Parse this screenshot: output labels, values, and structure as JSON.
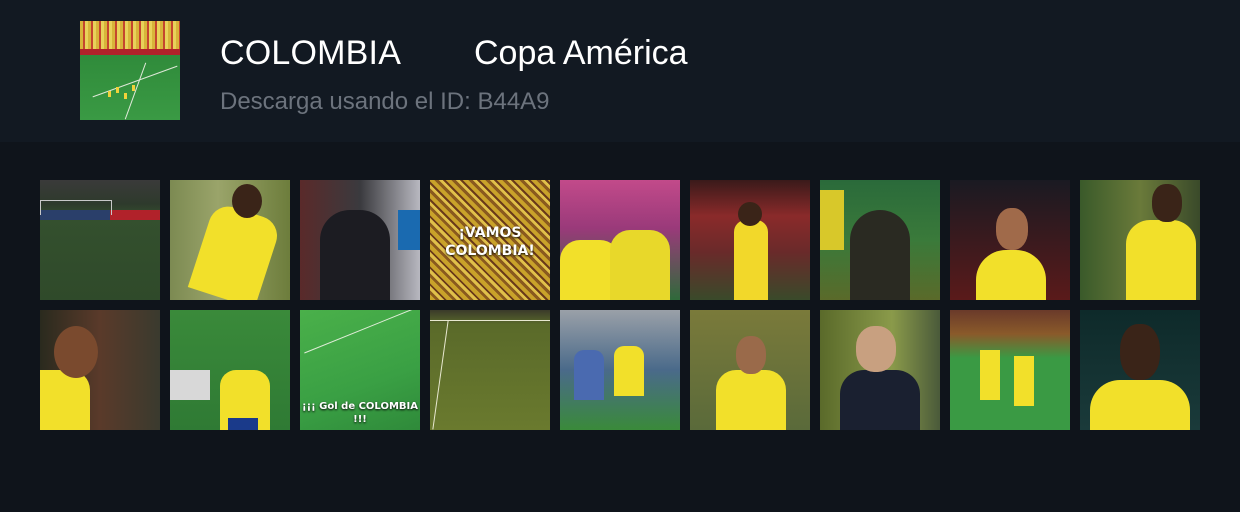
{
  "header": {
    "team": "COLOMBIA",
    "competition": "Copa América",
    "download_text": "Descarga usando el ID: B44A9"
  },
  "thumbnails": {
    "row1": [
      {
        "name": "wide-pitch-clip"
      },
      {
        "name": "player-7-celebration-clip"
      },
      {
        "name": "bench-hug-clip"
      },
      {
        "name": "vamos-colombia-clip",
        "caption": "¡VAMOS COLOMBIA!"
      },
      {
        "name": "team-celebration-clip"
      },
      {
        "name": "player-running-clip"
      },
      {
        "name": "crowd-celebration-clip"
      },
      {
        "name": "player-closeup-clip"
      },
      {
        "name": "player-gesture-clip"
      }
    ],
    "row2": [
      {
        "name": "player-back-closeup-clip"
      },
      {
        "name": "goal-hug-clip"
      },
      {
        "name": "gol-de-colombia-clip",
        "caption": "¡¡¡ Gol de COLOMBIA !!!"
      },
      {
        "name": "aerial-pitch-clip"
      },
      {
        "name": "goalmouth-action-clip"
      },
      {
        "name": "player-10-celebration-clip"
      },
      {
        "name": "coach-celebration-clip"
      },
      {
        "name": "freekick-celebration-clip"
      },
      {
        "name": "player-portrait-clip"
      }
    ]
  },
  "colors": {
    "background": "#0f141b",
    "header_background": "#121922",
    "title": "#ffffff",
    "subtitle": "#6c737d",
    "kit_yellow": "#f2e02a"
  }
}
